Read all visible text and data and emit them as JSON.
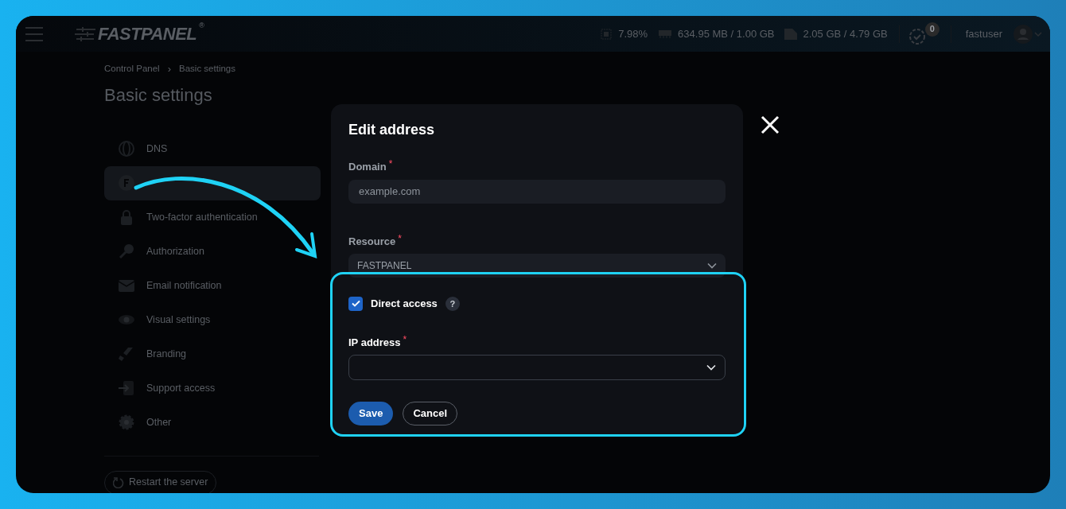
{
  "header": {
    "logo": "FASTPANEL",
    "logo_mark": "®",
    "cpu": "7.98%",
    "memory": "634.95 MB / 1.00 GB",
    "disk": "2.05 GB / 4.79 GB",
    "notifications": "0",
    "user": "fastuser"
  },
  "breadcrumbs": [
    "Control Panel",
    "Basic settings"
  ],
  "breadcrumb_separator": "›",
  "page_title": "Basic settings",
  "sidebar": {
    "items": [
      {
        "kind": "globe",
        "label": "DNS",
        "selected": false
      },
      {
        "kind": "badge",
        "selected": true
      },
      {
        "kind": "lock",
        "label": "Two-factor authentication",
        "selected": false
      },
      {
        "kind": "key",
        "label": "Authorization",
        "selected": false
      },
      {
        "kind": "mail",
        "label": "Email notification",
        "selected": false
      },
      {
        "kind": "eye",
        "label": "Visual settings",
        "selected": false
      },
      {
        "kind": "brush",
        "label": "Branding",
        "selected": false
      },
      {
        "kind": "enter",
        "label": "Support access",
        "selected": false
      },
      {
        "kind": "gear",
        "label": "Other",
        "selected": false
      }
    ],
    "restart_button": "Restart the server"
  },
  "dialog": {
    "title": "Edit address",
    "domain": {
      "label": "Domain",
      "required_mark": "*",
      "placeholder": "example.com"
    },
    "resource": {
      "label": "Resource",
      "required_mark": "*",
      "value": "FASTPANEL"
    },
    "direct_access": {
      "label": "Direct access",
      "checked": true,
      "help": "?"
    },
    "ip_address": {
      "label": "IP address",
      "required_mark": "*"
    },
    "buttons": [
      {
        "kind": "primary",
        "label": "Save"
      },
      {
        "kind": "secondary",
        "label": "Cancel"
      }
    ]
  }
}
